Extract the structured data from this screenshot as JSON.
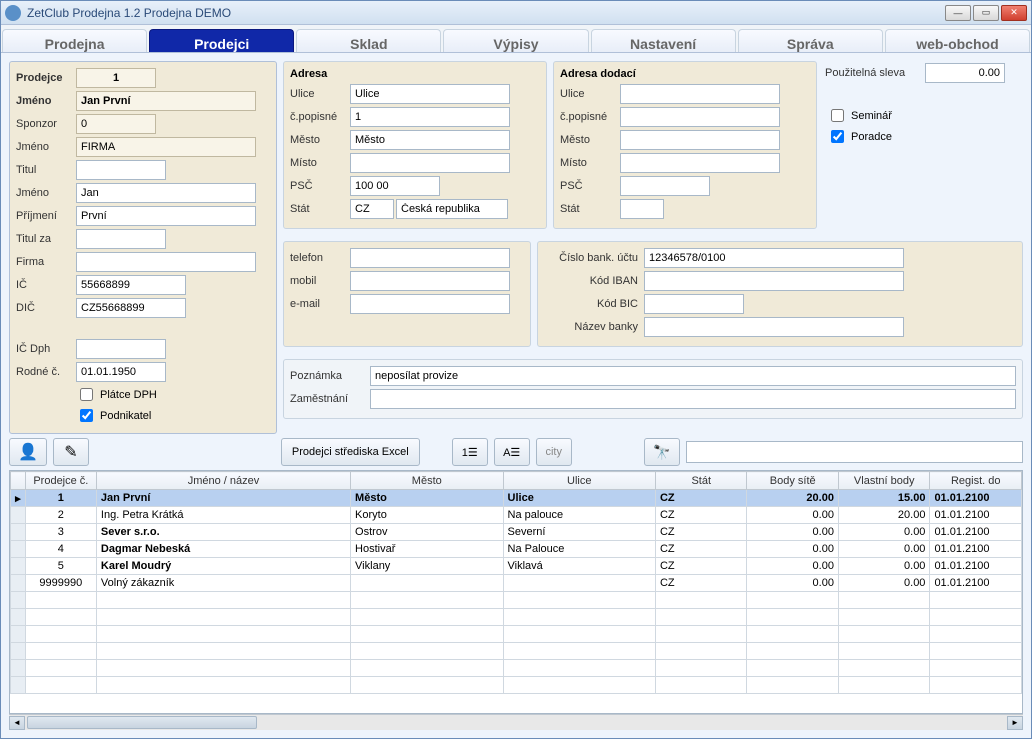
{
  "window": {
    "title": "ZetClub Prodejna 1.2  Prodejna DEMO"
  },
  "tabs": [
    "Prodejna",
    "Prodejci",
    "Sklad",
    "Výpisy",
    "Nastavení",
    "Správa",
    "web-obchod"
  ],
  "active_tab": 1,
  "left": {
    "prodejce_lbl": "Prodejce",
    "prodejce": "1",
    "jmeno1_lbl": "Jméno",
    "jmeno1": "Jan První",
    "sponzor_lbl": "Sponzor",
    "sponzor": "0",
    "jmeno2_lbl": "Jméno",
    "jmeno2": "FIRMA",
    "titul_lbl": "Titul",
    "titul": "",
    "jmeno3_lbl": "Jméno",
    "jmeno3": "Jan",
    "prijmeni_lbl": "Příjmení",
    "prijmeni": "První",
    "titulza_lbl": "Titul za",
    "titulza": "",
    "firma_lbl": "Firma",
    "firma": "",
    "ic_lbl": "IČ",
    "ic": "55668899",
    "dic_lbl": "DIČ",
    "dic": "CZ55668899",
    "icdph_lbl": "IČ Dph",
    "icdph": "",
    "rodne_lbl": "Rodné č.",
    "rodne": "01.01.1950",
    "platce_lbl": "Plátce DPH",
    "platce": false,
    "podnikatel_lbl": "Podnikatel",
    "podnikatel": true
  },
  "adresa": {
    "header": "Adresa",
    "ulice_lbl": "Ulice",
    "ulice": "Ulice",
    "cp_lbl": "č.popisné",
    "cp": "1",
    "mesto_lbl": "Město",
    "mesto": "Město",
    "misto_lbl": "Místo",
    "misto": "",
    "psc_lbl": "PSČ",
    "psc": "100 00",
    "stat_lbl": "Stát",
    "stat_code": "CZ",
    "stat_name": "Česká republika"
  },
  "dodaci": {
    "header": "Adresa dodací",
    "ulice_lbl": "Ulice",
    "ulice": "",
    "cp_lbl": "č.popisné",
    "cp": "",
    "mesto_lbl": "Město",
    "mesto": "",
    "misto_lbl": "Místo",
    "misto": "",
    "psc_lbl": "PSČ",
    "psc": "",
    "stat_lbl": "Stát",
    "stat": ""
  },
  "contact": {
    "telefon_lbl": "telefon",
    "telefon": "",
    "mobil_lbl": "mobil",
    "mobil": "",
    "email_lbl": "e-mail",
    "email": ""
  },
  "bank": {
    "ucet_lbl": "Číslo bank. účtu",
    "ucet": "12346578/0100",
    "iban_lbl": "Kód IBAN",
    "iban": "",
    "bic_lbl": "Kód BIC",
    "bic": "",
    "nazev_lbl": "Název banky",
    "nazev": ""
  },
  "right": {
    "sleva_lbl": "Použitelná sleva",
    "sleva": "0.00",
    "seminar_lbl": "Seminář",
    "seminar": false,
    "poradce_lbl": "Poradce",
    "poradce": true
  },
  "notes": {
    "poznamka_lbl": "Poznámka",
    "poznamka": "neposílat provize",
    "zamestnani_lbl": "Zaměstnání",
    "zamestnani": ""
  },
  "toolbar": {
    "excel": "Prodejci střediska Excel"
  },
  "grid": {
    "columns": [
      "Prodejce č.",
      "Jméno / název",
      "Město",
      "Ulice",
      "Stát",
      "Body sítě",
      "Vlastní body",
      "Regist. do"
    ],
    "rows": [
      {
        "c": "1",
        "name": "Jan  První",
        "mesto": "Město",
        "ulice": "Ulice",
        "stat": "CZ",
        "body": "20.00",
        "vlastni": "15.00",
        "reg": "01.01.2100",
        "sel": true,
        "bold": true
      },
      {
        "c": "2",
        "name": "Ing. Petra  Krátká",
        "mesto": "Koryto",
        "ulice": "Na palouce",
        "stat": "CZ",
        "body": "0.00",
        "vlastni": "20.00",
        "reg": "01.01.2100",
        "bold": false
      },
      {
        "c": "3",
        "name": "Sever s.r.o.",
        "mesto": "Ostrov",
        "ulice": "Severní",
        "stat": "CZ",
        "body": "0.00",
        "vlastni": "0.00",
        "reg": "01.01.2100",
        "bold": true
      },
      {
        "c": "4",
        "name": "Dagmar  Nebeská",
        "mesto": "Hostivař",
        "ulice": "Na Palouce",
        "stat": "CZ",
        "body": "0.00",
        "vlastni": "0.00",
        "reg": "01.01.2100",
        "bold": true
      },
      {
        "c": "5",
        "name": "Karel  Moudrý",
        "mesto": "Viklany",
        "ulice": "Viklavá",
        "stat": "CZ",
        "body": "0.00",
        "vlastni": "0.00",
        "reg": "01.01.2100",
        "bold": true
      },
      {
        "c": "9999990",
        "name": "Volný zákazník",
        "mesto": "",
        "ulice": "",
        "stat": "CZ",
        "body": "0.00",
        "vlastni": "0.00",
        "reg": "01.01.2100",
        "bold": false
      }
    ]
  }
}
